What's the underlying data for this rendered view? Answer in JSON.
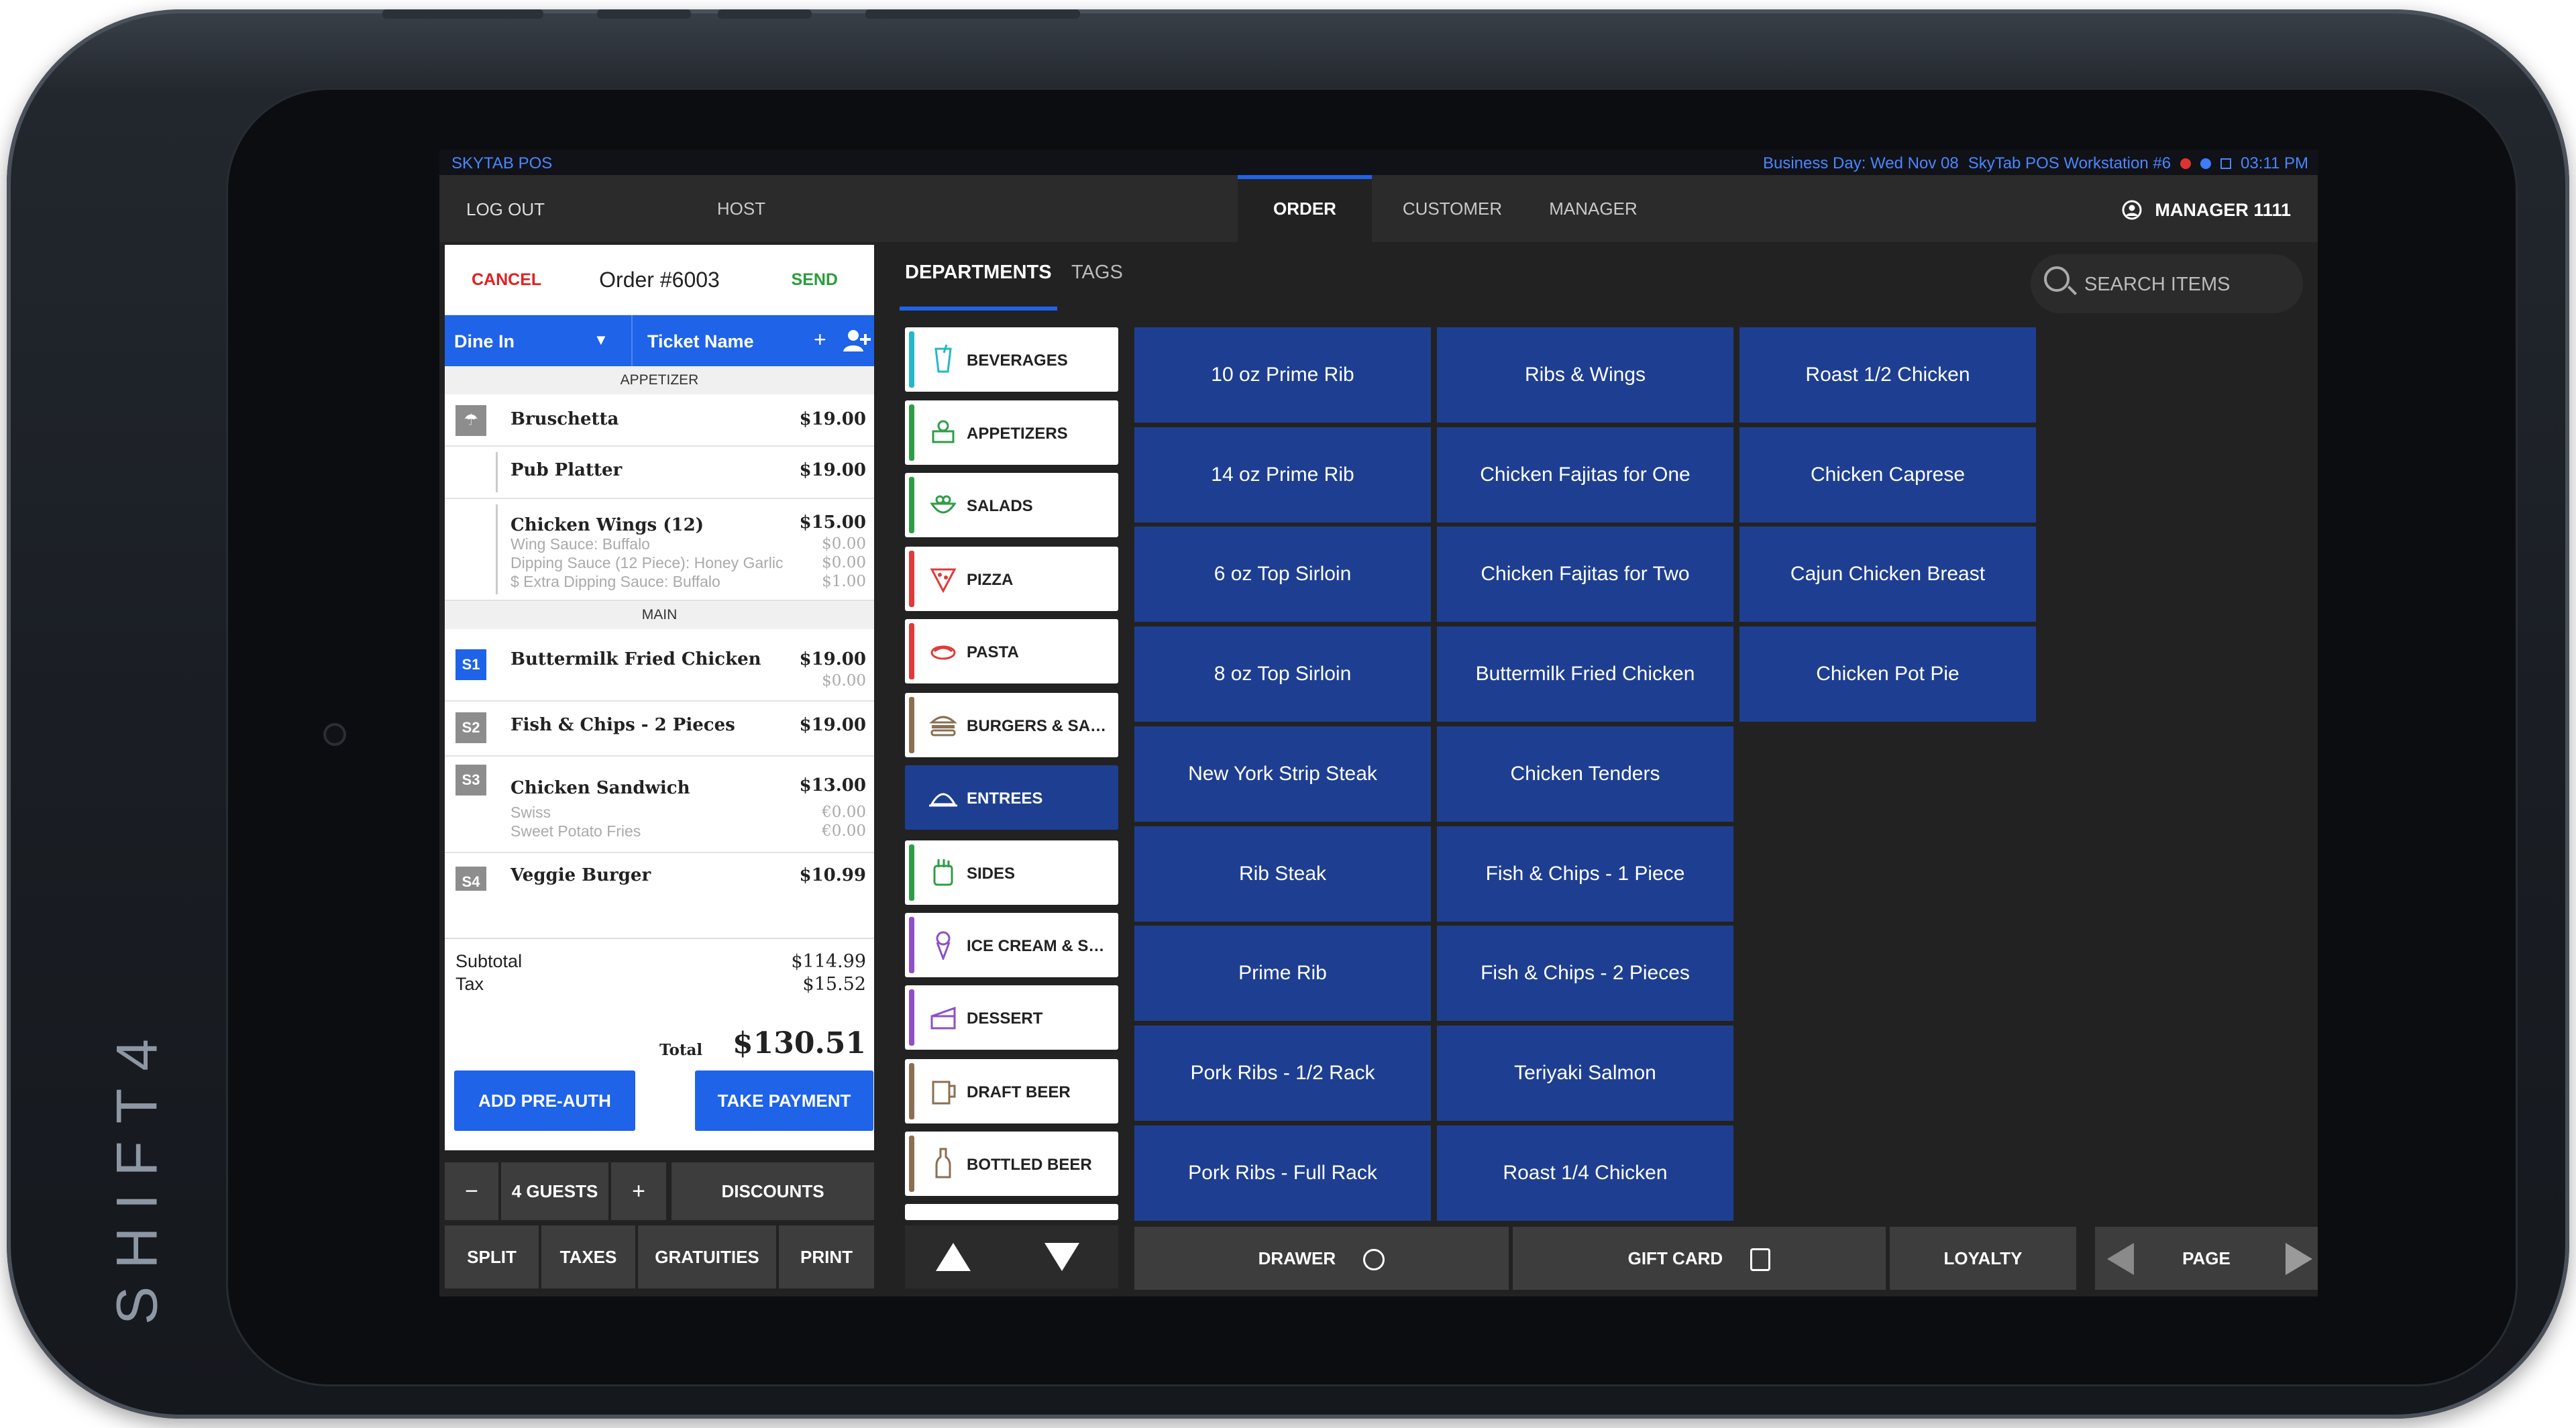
{
  "device": {
    "brand": "SHIFT4"
  },
  "status_bar": {
    "app_name": "SKYTAB POS",
    "business_day": "Business Day: Wed Nov 08",
    "workstation": "SkyTab POS Workstation #6",
    "time": "03:11 PM"
  },
  "nav": {
    "logout": "LOG OUT",
    "tabs": [
      {
        "label": "HOST"
      },
      {
        "label": "ORDER",
        "active": true
      },
      {
        "label": "CUSTOMER"
      },
      {
        "label": "MANAGER"
      }
    ],
    "user": "MANAGER 1111"
  },
  "order": {
    "cancel": "CANCEL",
    "title": "Order #6003",
    "send": "SEND",
    "type": "Dine In",
    "ticket_name": "Ticket Name",
    "sections": {
      "appetizer": "APPETIZER",
      "main": "MAIN"
    },
    "items": [
      {
        "name": "Bruschetta",
        "price": "$19.00"
      },
      {
        "name": "Pub Platter",
        "price": "$19.00"
      },
      {
        "name": "Chicken Wings (12)",
        "price": "$15.00",
        "mods": [
          {
            "text": "Wing Sauce: Buffalo",
            "price": "$0.00"
          },
          {
            "text": "Dipping Sauce (12 Piece): Honey Garlic",
            "price": "$0.00"
          },
          {
            "text": "$ Extra Dipping Sauce: Buffalo",
            "price": "$1.00"
          }
        ]
      },
      {
        "seat": "S1",
        "name": "Buttermilk Fried Chicken",
        "price": "$19.00",
        "sub_price": "$0.00"
      },
      {
        "seat": "S2",
        "name": "Fish & Chips - 2 Pieces",
        "price": "$19.00"
      },
      {
        "seat": "S3",
        "name": "Chicken Sandwich",
        "price": "$13.00",
        "mods": [
          {
            "text": "Swiss",
            "price": "€0.00"
          },
          {
            "text": "Sweet Potato Fries",
            "price": "€0.00"
          }
        ]
      },
      {
        "seat": "S4",
        "name": "Veggie Burger",
        "price": "$10.99"
      }
    ],
    "subtotal_label": "Subtotal",
    "subtotal": "$114.99",
    "tax_label": "Tax",
    "tax": "$15.52",
    "total_label": "Total",
    "total": "$130.51",
    "add_preauth": "ADD PRE-AUTH",
    "take_payment": "TAKE PAYMENT"
  },
  "order_actions": {
    "minus": "−",
    "guests": "4 GUESTS",
    "plus": "+",
    "discounts": "DISCOUNTS",
    "split": "SPLIT",
    "taxes": "TAXES",
    "gratuities": "GRATUITIES",
    "print": "PRINT"
  },
  "menu_tabs": {
    "departments": "DEPARTMENTS",
    "tags": "TAGS"
  },
  "search": {
    "placeholder": "SEARCH ITEMS"
  },
  "departments": [
    {
      "label": "BEVERAGES",
      "color": "#23b8c7",
      "icon": "cup-icon"
    },
    {
      "label": "APPETIZERS",
      "color": "#2f9d48",
      "icon": "appetizer-icon"
    },
    {
      "label": "SALADS",
      "color": "#2f9d48",
      "icon": "salad-icon"
    },
    {
      "label": "PIZZA",
      "color": "#e03a3a",
      "icon": "pizza-icon"
    },
    {
      "label": "PASTA",
      "color": "#e03a3a",
      "icon": "pasta-icon"
    },
    {
      "label": "BURGERS & SAL...",
      "color": "#8a6f52",
      "icon": "burger-icon"
    },
    {
      "label": "ENTREES",
      "color": "#1e3f91",
      "icon": "cloche-icon",
      "active": true
    },
    {
      "label": "SIDES",
      "color": "#2f9d48",
      "icon": "sides-icon"
    },
    {
      "label": "ICE CREAM & SH...",
      "color": "#8e4fc7",
      "icon": "icecream-icon"
    },
    {
      "label": "DESSERT",
      "color": "#8e4fc7",
      "icon": "cake-icon"
    },
    {
      "label": "DRAFT BEER",
      "color": "#8a6f52",
      "icon": "mug-icon"
    },
    {
      "label": "BOTTLED BEER",
      "color": "#8a6f52",
      "icon": "bottle-icon"
    }
  ],
  "menu_items": [
    [
      "10 oz Prime Rib",
      "Ribs & Wings",
      "Roast 1/2 Chicken"
    ],
    [
      "14 oz Prime Rib",
      "Chicken Fajitas for One",
      "Chicken Caprese"
    ],
    [
      "6 oz Top Sirloin",
      "Chicken Fajitas for Two",
      "Cajun Chicken Breast"
    ],
    [
      "8 oz Top Sirloin",
      "Buttermilk Fried Chicken",
      "Chicken Pot Pie"
    ],
    [
      "New York Strip Steak",
      "Chicken Tenders"
    ],
    [
      "Rib Steak",
      "Fish & Chips - 1 Piece"
    ],
    [
      "Prime Rib",
      "Fish & Chips - 2 Pieces"
    ],
    [
      "Pork Ribs - 1/2 Rack",
      "Teriyaki Salmon"
    ],
    [
      "Pork Ribs - Full Rack",
      "Roast 1/4 Chicken"
    ]
  ],
  "footer": {
    "drawer": "DRAWER",
    "gift_card": "GIFT CARD",
    "loyalty": "LOYALTY",
    "page": "PAGE"
  },
  "colors": {
    "accent": "#1e63e8",
    "menu_button": "#1e3f91",
    "cancel": "#e32020",
    "send": "#2a9d3a"
  }
}
